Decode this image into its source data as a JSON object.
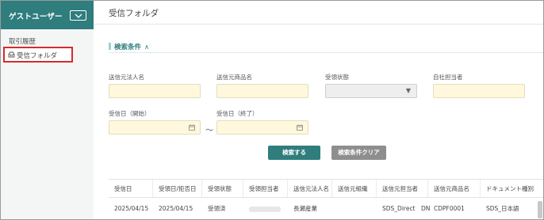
{
  "sidebar": {
    "user_name": "ゲストユーザー",
    "items": [
      {
        "label": "取引履歴"
      },
      {
        "label": "受信フォルダ"
      }
    ]
  },
  "page": {
    "title": "受信フォルダ"
  },
  "search": {
    "section_title": "検索条件",
    "caret": "∧",
    "fields": {
      "sender_company": "送信元法人名",
      "sender_product": "送信元商品名",
      "receipt_status": "受領状態",
      "own_staff": "自社担当者",
      "received_from": "受信日（開始）",
      "received_to": "受信日（終了）"
    },
    "range_separator": "～",
    "search_button": "検索する",
    "clear_button": "検索条件クリア"
  },
  "table": {
    "columns": [
      "受信日",
      "受領日/拒否日",
      "受領状態",
      "受領担当者",
      "送信元法人名",
      "送信元組織",
      "送信元担当者",
      "送信元商品名",
      "ドキュメント種別"
    ],
    "rows": [
      [
        "2025/04/15",
        "2025/04/15",
        "受領済",
        "",
        "長瀬産業",
        "",
        "SDS_Direct　DN",
        "CDPF0001",
        "SDS_日本語"
      ]
    ]
  },
  "colors": {
    "brand": "#2f7d7d",
    "input_bg": "#fff8dc",
    "highlight": "#d62b2b"
  },
  "icons": [
    "chevron-down-icon",
    "inbox-icon",
    "calendar-icon",
    "dropdown-arrow-icon"
  ]
}
